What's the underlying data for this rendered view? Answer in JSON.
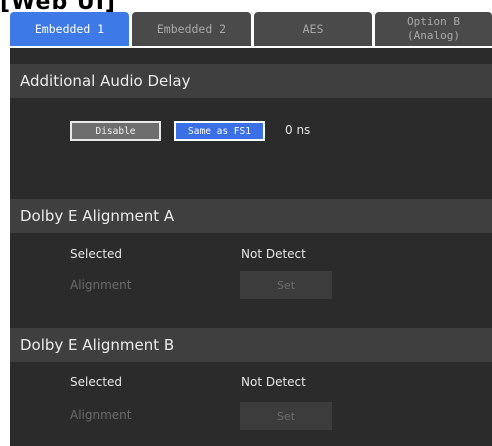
{
  "page_title": "[Web UI]",
  "tabs": [
    {
      "label": "Embedded 1"
    },
    {
      "label": "Embedded 2"
    },
    {
      "label": "AES"
    },
    {
      "label_line1": "Option B",
      "label_line2": "(Analog)"
    }
  ],
  "colors": {
    "active_tab": "#3d7ae8",
    "panel_bg": "#2b2b2b",
    "section_header_bg": "#3f3f3f",
    "selected_button": "#3b6fe6"
  },
  "audio_delay": {
    "title": "Additional Audio Delay",
    "disable_label": "Disable",
    "same_as_fs1_label": "Same as FS1",
    "value": "0 ns"
  },
  "dolby_a": {
    "title": "Dolby E Alignment A",
    "selected_label": "Selected",
    "selected_value": "Not Detect",
    "alignment_label": "Alignment",
    "set_label": "Set"
  },
  "dolby_b": {
    "title": "Dolby E Alignment B",
    "selected_label": "Selected",
    "selected_value": "Not Detect",
    "alignment_label": "Alignment",
    "set_label": "Set"
  }
}
